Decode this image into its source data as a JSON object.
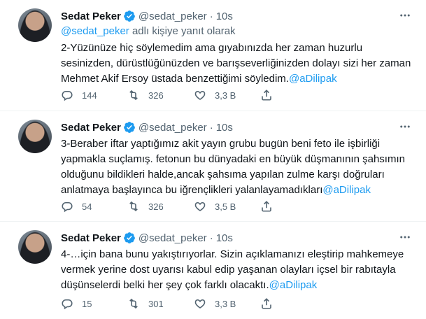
{
  "tweets": [
    {
      "author_name": "Sedat Peker",
      "handle": "@sedat_peker",
      "separator": "·",
      "time": "10s",
      "replying_to": {
        "user": "@sedat_peker",
        "suffix": " adlı kişiye yanıt olarak"
      },
      "text": "2-Yüzünüze hiç söylemedim ama gıyabınızda her zaman huzurlu sesinizden, dürüstlüğünüzden ve barışseverliğinizden dolayı sizi her zaman Mehmet Akif Ersoy üstada benzettiğimi söyledim.",
      "mention": "@aDilipak",
      "replies": "144",
      "retweets": "326",
      "likes": "3,3 B"
    },
    {
      "author_name": "Sedat Peker",
      "handle": "@sedat_peker",
      "separator": "·",
      "time": "10s",
      "text": "3-Beraber iftar yaptığımız akit yayın grubu bugün beni feto ile işbirliği yapmakla suçlamış. fetonun bu dünyadaki en büyük düşmanının şahsımın olduğunu bildikleri halde,ancak şahsıma yapılan zulme karşı doğruları anlatmaya başlayınca bu iğrençlikleri yalanlayamadıkları",
      "mention": "@aDilipak",
      "replies": "54",
      "retweets": "326",
      "likes": "3,5 B"
    },
    {
      "author_name": "Sedat Peker",
      "handle": "@sedat_peker",
      "separator": "·",
      "time": "10s",
      "text": "4-…için bana bunu yakıştırıyorlar. Sizin açıklamanızı eleştirip mahkemeye vermek yerine dost uyarısı kabul edip yaşanan olayları içsel bir rabıtayla düşünselerdi belki her şey çok farklı olacaktı.",
      "mention": "@aDilipak",
      "replies": "15",
      "retweets": "301",
      "likes": "3,3 B"
    }
  ],
  "colors": {
    "accent": "#1d9bf0",
    "secondary_text": "#536471",
    "primary_text": "#0f1419",
    "divider": "#eff3f4"
  },
  "icons": {
    "verified": "verified-badge-icon",
    "more": "more-horizontal-icon",
    "reply": "reply-icon",
    "retweet": "retweet-icon",
    "like": "heart-icon",
    "share": "share-icon"
  }
}
